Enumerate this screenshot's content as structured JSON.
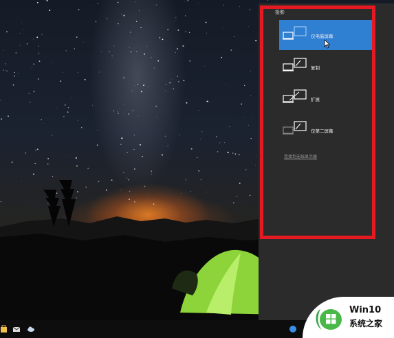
{
  "panel": {
    "title": "投影",
    "items": [
      {
        "label": "仅电脑屏幕",
        "icon": "pc-screen-only-icon",
        "active": true
      },
      {
        "label": "复制",
        "icon": "duplicate-icon",
        "active": false
      },
      {
        "label": "扩展",
        "icon": "extend-icon",
        "active": false
      },
      {
        "label": "仅第二屏幕",
        "icon": "second-screen-only-icon",
        "active": false
      }
    ],
    "wireless_link": "连接到无线显示器"
  },
  "watermark": {
    "title": "Win10",
    "subtitle": "系统之家"
  },
  "colors": {
    "active_item": "#2f7fd3",
    "highlight_border": "#e51922",
    "panel_bg": "#2b2b2b",
    "tent": "#8cd43a"
  }
}
